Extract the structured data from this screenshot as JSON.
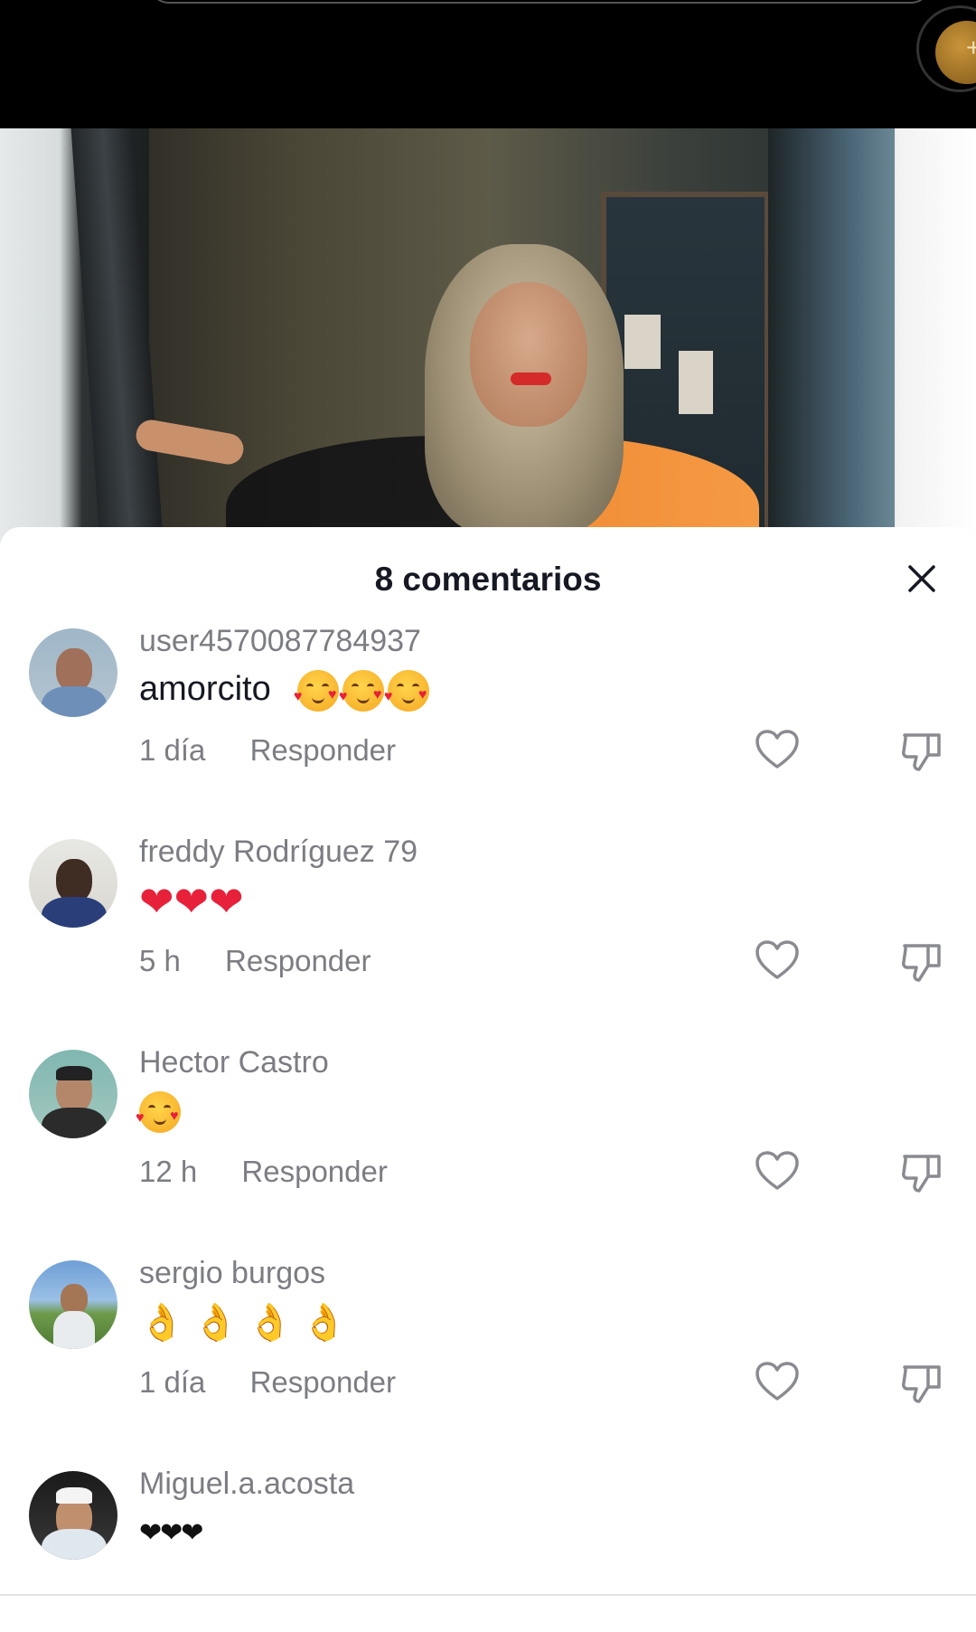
{
  "sheet": {
    "title": "8 comentarios"
  },
  "comments": [
    {
      "username": "user4570087784937",
      "text": "amorcito",
      "emoji": "smiling-face-with-hearts x3",
      "time": "1 día",
      "reply_label": "Responder"
    },
    {
      "username": "freddy Rodríguez 79",
      "text": "",
      "emoji": "red-heart x3",
      "time": "5 h",
      "reply_label": "Responder"
    },
    {
      "username": "Hector Castro",
      "text": "",
      "emoji": "smiling-face-with-hearts x1",
      "time": "12 h",
      "reply_label": "Responder"
    },
    {
      "username": "sergio burgos",
      "text": "",
      "emoji": "ok-hand x4",
      "time": "1 día",
      "reply_label": "Responder"
    },
    {
      "username": "Miguel.a.acosta",
      "text": "",
      "emoji": "black-heart x3",
      "time": "",
      "reply_label": ""
    }
  ],
  "colors": {
    "title": "#161823",
    "secondary_text": "#7c7d83",
    "heart_red": "#e8213a",
    "sheet_bg": "#ffffff"
  },
  "icons": {
    "close": "close-icon",
    "like": "heart-outline-icon",
    "dislike": "thumbs-down-outline-icon"
  }
}
